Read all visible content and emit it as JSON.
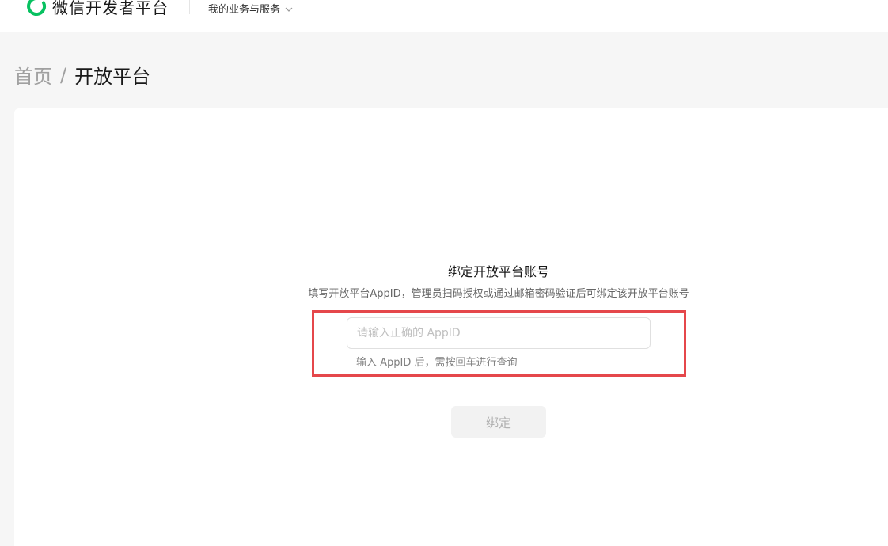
{
  "header": {
    "logo_icon": "wechat-ring-logo-icon",
    "brand_color": "#07c160",
    "app_title": "微信开发者平台",
    "menu_label": "我的业务与服务",
    "menu_icon": "chevron-down-icon"
  },
  "breadcrumb": {
    "home": "首页",
    "separator": "/",
    "current": "开放平台"
  },
  "bind": {
    "title": "绑定开放平台账号",
    "description": "填写开放平台AppID，管理员扫码授权或通过邮箱密码验证后可绑定该开放平台账号",
    "input_placeholder": "请输入正确的 AppID",
    "input_value": "",
    "hint": "输入 AppID 后，需按回车进行查询",
    "button_label": "绑定",
    "highlight_color": "#e5474b"
  }
}
